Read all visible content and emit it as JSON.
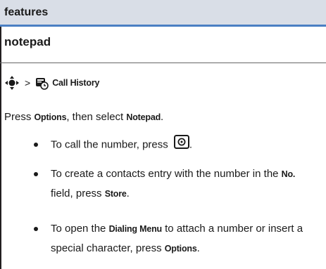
{
  "section": {
    "title": "features"
  },
  "subsection": {
    "title": "notepad"
  },
  "nav": {
    "separator": ">",
    "destination": "Call History"
  },
  "intro": {
    "prefix": "Press ",
    "options_key": "Options",
    "middle": ", then select ",
    "notepad_key": "Notepad",
    "suffix": "."
  },
  "bullets": [
    {
      "text_before": "To call the number, press ",
      "key_icon": "send-key-icon",
      "text_after": "."
    },
    {
      "text_before": "To create a contacts entry with the number in the ",
      "field": "No.",
      "text_middle": " field, press ",
      "key": "Store",
      "text_after": "."
    },
    {
      "text_before": "To open the ",
      "menu": "Dialing Menu",
      "text_middle": " to attach a number or insert a special character, press ",
      "key": "Options",
      "text_after": "."
    }
  ],
  "colors": {
    "header_bg": "#d9dee7",
    "accent_rule": "#4a7fc3",
    "text": "#1a1a1a"
  }
}
